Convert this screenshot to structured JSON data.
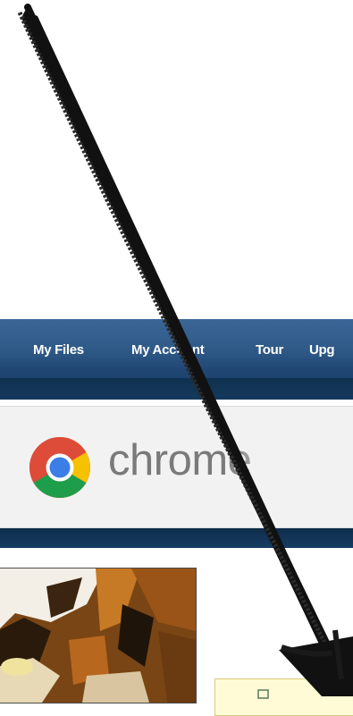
{
  "nav": {
    "items": [
      {
        "label": "My Files"
      },
      {
        "label": "My Account"
      },
      {
        "label": "Tour"
      },
      {
        "label": "Upg"
      }
    ]
  },
  "banner": {
    "brand_text": "chrome",
    "logo_icon": "chrome-logo-icon"
  },
  "colors": {
    "nav_blue": "#2f5a88",
    "nav_dark": "#163a63",
    "banner_bg": "#f2f2f2",
    "action_box_bg": "#fffbd6",
    "arrow": "#111111"
  },
  "annotation": {
    "arrow_icon": "hand-drawn-arrow-icon"
  }
}
